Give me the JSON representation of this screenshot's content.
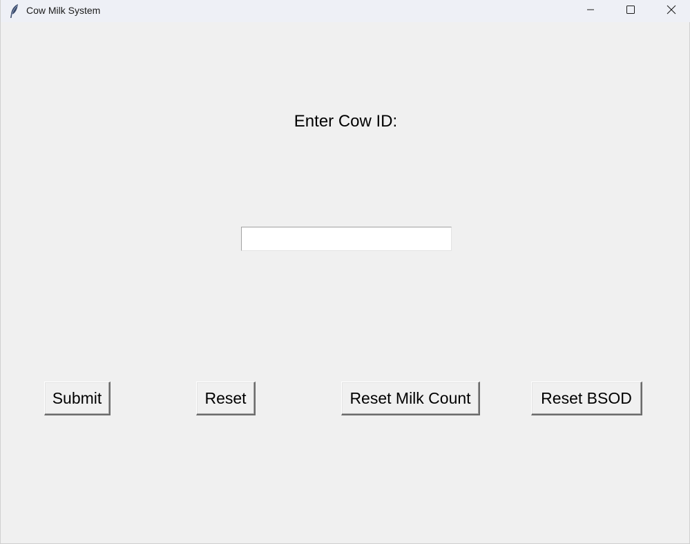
{
  "window": {
    "title": "Cow Milk System",
    "controls": {
      "minimize_icon": "minimize-icon",
      "maximize_icon": "maximize-icon",
      "close_icon": "close-icon"
    }
  },
  "form": {
    "prompt_label": "Enter Cow ID:",
    "cow_id_value": "",
    "cow_id_placeholder": ""
  },
  "buttons": {
    "submit": "Submit",
    "reset": "Reset",
    "reset_milk_count": "Reset Milk Count",
    "reset_bsod": "Reset BSOD"
  },
  "colors": {
    "background": "#f0f0f0",
    "titlebar": "#eef0f6",
    "text": "#000000"
  }
}
